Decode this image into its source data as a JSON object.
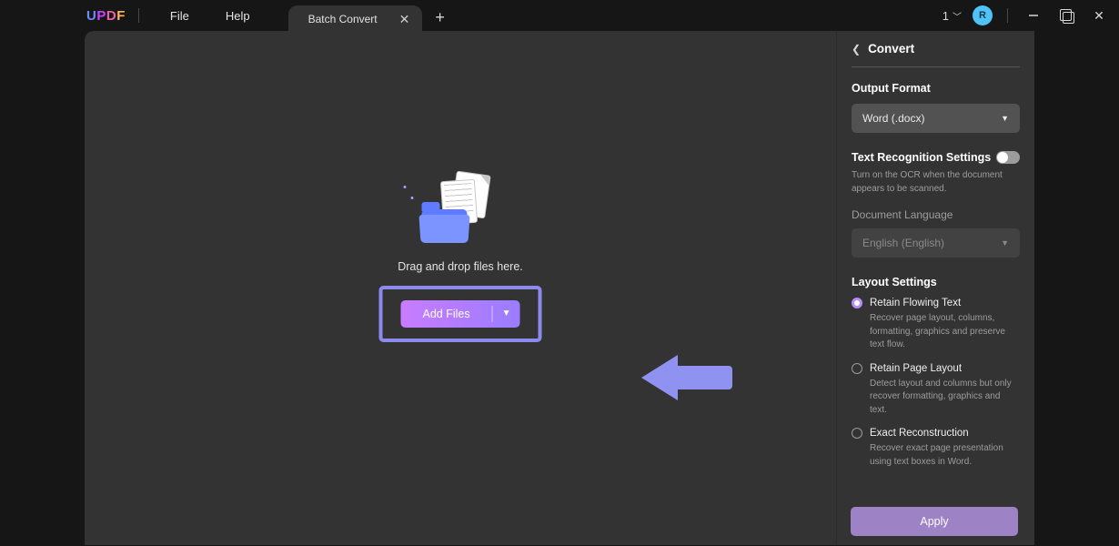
{
  "logo": "UPDF",
  "menu": {
    "file": "File",
    "help": "Help"
  },
  "tab": {
    "title": "Batch Convert"
  },
  "counter": "1",
  "avatar_letter": "R",
  "drop_text": "Drag and drop files here.",
  "add_files": "Add Files",
  "panel": {
    "title": "Convert",
    "output_format_title": "Output Format",
    "output_format_value": "Word (.docx)",
    "text_recog_title": "Text Recognition Settings",
    "text_recog_help": "Turn on the OCR when the document appears to be scanned.",
    "doc_lang_title": "Document Language",
    "doc_lang_value": "English (English)",
    "layout_title": "Layout Settings",
    "opt1_label": "Retain Flowing Text",
    "opt1_help": "Recover page layout, columns, formatting, graphics and preserve text flow.",
    "opt2_label": "Retain Page Layout",
    "opt2_help": "Detect layout and columns but only recover formatting, graphics and text.",
    "opt3_label": "Exact Reconstruction",
    "opt3_help": "Recover exact page presentation using text boxes in Word.",
    "apply": "Apply"
  }
}
